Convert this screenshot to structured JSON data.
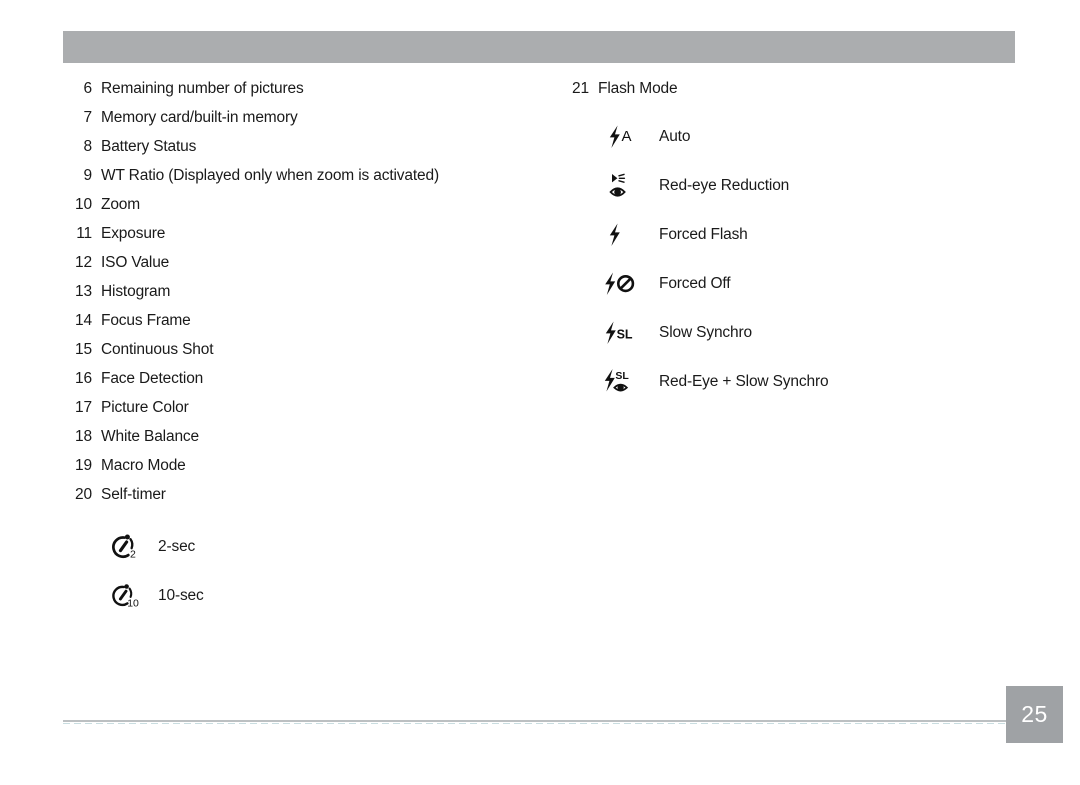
{
  "header": {
    "bar_color": "#abadaf",
    "title": ""
  },
  "left_column": {
    "items": [
      {
        "num": "6",
        "label": "Remaining number of pictures"
      },
      {
        "num": "7",
        "label": "Memory card/built-in memory"
      },
      {
        "num": "8",
        "label": "Battery Status"
      },
      {
        "num": "9",
        "label": "WT Ratio (Displayed only when zoom is activated)"
      },
      {
        "num": "10",
        "label": "Zoom"
      },
      {
        "num": "11",
        "label": "Exposure"
      },
      {
        "num": "12",
        "label": "ISO Value"
      },
      {
        "num": "13",
        "label": "Histogram"
      },
      {
        "num": "14",
        "label": "Focus Frame"
      },
      {
        "num": "15",
        "label": "Continuous Shot"
      },
      {
        "num": "16",
        "label": "Face Detection"
      },
      {
        "num": "17",
        "label": "Picture Color"
      },
      {
        "num": "18",
        "label": "White Balance"
      },
      {
        "num": "19",
        "label": "Macro Mode"
      },
      {
        "num": "20",
        "label": "Self-timer"
      }
    ],
    "self_timer_options": [
      {
        "icon": "timer-2sec-icon",
        "badge": "2",
        "label": "2-sec"
      },
      {
        "icon": "timer-10sec-icon",
        "badge": "10",
        "label": "10-sec"
      }
    ]
  },
  "right_column": {
    "section": {
      "num": "21",
      "label": "Flash Mode"
    },
    "flash_options": [
      {
        "icon": "flash-auto-icon",
        "label": "Auto"
      },
      {
        "icon": "flash-red-eye-reduction-icon",
        "label": "Red-eye Reduction"
      },
      {
        "icon": "flash-forced-icon",
        "label": "Forced Flash"
      },
      {
        "icon": "flash-forced-off-icon",
        "label": "Forced Off"
      },
      {
        "icon": "flash-slow-synchro-icon",
        "label": "Slow Synchro"
      },
      {
        "icon": "flash-red-eye-slow-synchro-icon",
        "label": "Red-Eye + Slow Synchro"
      }
    ]
  },
  "footer": {
    "page_number": "25",
    "box_color": "#9fa2a5",
    "rule_color": "#bcc0c2"
  }
}
